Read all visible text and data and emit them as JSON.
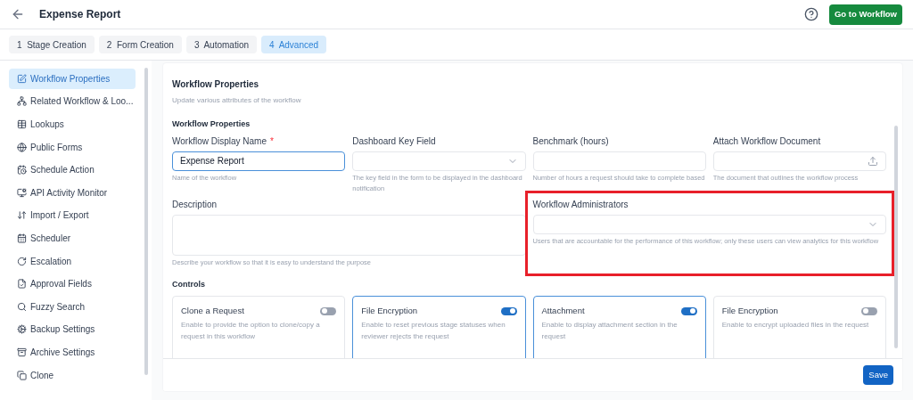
{
  "header": {
    "title": "Expense Report",
    "action_button": "Go to Workflow"
  },
  "steps": [
    {
      "number": "1",
      "label": "Stage Creation",
      "selected": false
    },
    {
      "number": "2",
      "label": "Form Creation",
      "selected": false
    },
    {
      "number": "3",
      "label": "Automation",
      "selected": false
    },
    {
      "number": "4",
      "label": "Advanced",
      "selected": true
    }
  ],
  "sidebar": {
    "items": [
      {
        "label": "Workflow Properties",
        "selected": true
      },
      {
        "label": "Related Workflow & Loo...",
        "selected": false
      },
      {
        "label": "Lookups",
        "selected": false
      },
      {
        "label": "Public Forms",
        "selected": false
      },
      {
        "label": "Schedule Action",
        "selected": false
      },
      {
        "label": "API Activity Monitor",
        "selected": false
      },
      {
        "label": "Import / Export",
        "selected": false
      },
      {
        "label": "Scheduler",
        "selected": false
      },
      {
        "label": "Escalation",
        "selected": false
      },
      {
        "label": "Approval Fields",
        "selected": false
      },
      {
        "label": "Fuzzy Search",
        "selected": false
      },
      {
        "label": "Backup Settings",
        "selected": false
      },
      {
        "label": "Archive Settings",
        "selected": false
      },
      {
        "label": "Clone",
        "selected": false
      }
    ]
  },
  "panel": {
    "title": "Workflow Properties",
    "subtitle": "Update various attributes of the workflow",
    "section_title": "Workflow Properties",
    "fields": [
      {
        "kind": "text",
        "label": "Workflow Display Name",
        "required_mark": "*",
        "value": "Expense Report",
        "focused": true,
        "highlighted": false,
        "hint": "Name of the workflow"
      },
      {
        "kind": "select",
        "label": "Dashboard Key Field",
        "focused": false,
        "highlighted": false,
        "hint": "The key field in the form to be displayed in the dashboard notification"
      },
      {
        "kind": "number",
        "label": "Benchmark (hours)",
        "focused": false,
        "highlighted": false,
        "hint": "Number of hours a request should take to complete based"
      },
      {
        "kind": "upload",
        "label": "Attach Workflow Document",
        "focused": false,
        "highlighted": false,
        "hint": "The document that outlines the workflow process"
      },
      {
        "kind": "textarea",
        "label": "Description",
        "focused": false,
        "highlighted": false,
        "hint": "Describe your workflow so that it is easy to understand the purpose"
      },
      {
        "kind": "multiselect",
        "label": "Workflow Administrators",
        "focused": false,
        "highlighted": true,
        "hint": "Users that are accountable for the performance of this workflow; only these users can view analytics for this workflow"
      }
    ],
    "controls_title": "Controls",
    "controls": [
      {
        "title": "Clone a Request",
        "description": "Enable to provide the option to clone/copy a request in this workflow",
        "on": false
      },
      {
        "title": "File Encryption",
        "description": "Enable to reset previous stage statuses when reviewer rejects the request",
        "on": true
      },
      {
        "title": "Attachment",
        "description": "Enable to display attachment section in the request",
        "on": true
      },
      {
        "title": "File Encryption",
        "description": "Enable to encrypt uploaded files in the request",
        "on": false
      }
    ],
    "save_button": "Save"
  }
}
